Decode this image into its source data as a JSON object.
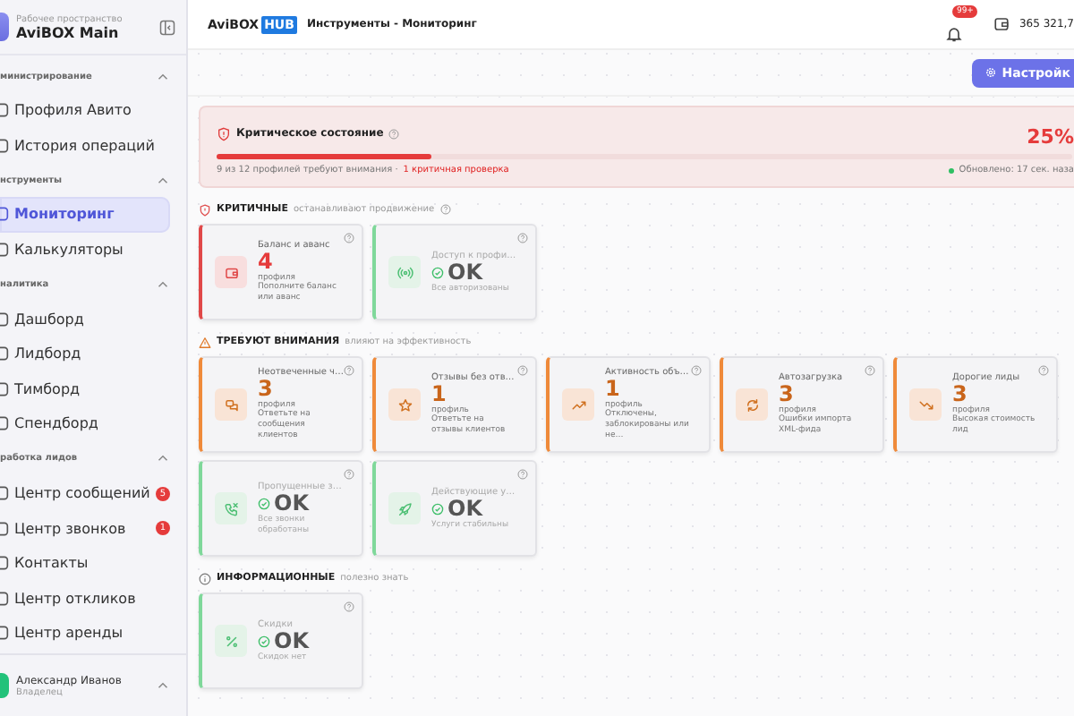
{
  "workspace": {
    "caption": "Рабочее пространство",
    "name": "AviBOX Main"
  },
  "sidebar": {
    "sections": [
      {
        "title": "министрирование",
        "expanded": true,
        "items": [
          {
            "label": "Профиля Авито",
            "selected": false
          },
          {
            "label": "История операций",
            "selected": false
          }
        ]
      },
      {
        "title": "нструменты",
        "expanded": true,
        "items": [
          {
            "label": "Мониторинг",
            "selected": true
          },
          {
            "label": "Калькуляторы",
            "selected": false
          }
        ]
      },
      {
        "title": "налитика",
        "expanded": true,
        "items": [
          {
            "label": "Дашборд",
            "selected": false
          },
          {
            "label": "Лидборд",
            "selected": false
          },
          {
            "label": "Тимборд",
            "selected": false
          },
          {
            "label": "Спендборд",
            "selected": false
          }
        ]
      },
      {
        "title": "работка лидов",
        "expanded": true,
        "items": [
          {
            "label": "Центр сообщений",
            "selected": false,
            "badge": "5"
          },
          {
            "label": "Центр звонков",
            "selected": false,
            "badge": "1"
          },
          {
            "label": "Контакты",
            "selected": false
          },
          {
            "label": "Центр откликов",
            "selected": false
          },
          {
            "label": "Центр аренды",
            "selected": false
          }
        ]
      }
    ]
  },
  "user": {
    "name": "Александр Иванов",
    "role": "Владелец"
  },
  "header": {
    "logo": "AviBOX",
    "logo_badge": "HUB",
    "title": "Инструменты - Мониторинг",
    "notifications": "99+",
    "balance": "365 321,7"
  },
  "toolbar": {
    "button": "Настройк"
  },
  "status_banner": {
    "title": "Критическое состояние",
    "level": 0.25,
    "percent": "25%",
    "summary": "9 из 12 профилей требуют внимания ·",
    "alert": "1 критичная проверка",
    "updated": "Обновлено: 17 сек. наза"
  },
  "sections": [
    {
      "kind": "critical",
      "title": "КРИТИЧНЫЕ",
      "subtitle": "останавливают продвижение",
      "cards": [
        {
          "kind": "critical",
          "title": "Баланс и аванс",
          "value": "4",
          "unit": "профиля",
          "desc": "Пополните баланс или аванс"
        },
        {
          "kind": "ok",
          "title": "Доступ к профи…",
          "value": "OK",
          "desc": "Все авторизованы"
        }
      ]
    },
    {
      "kind": "warning",
      "title": "ТРЕБУЮТ ВНИМАНИЯ",
      "subtitle": "влияют на эффективность",
      "cards": [
        {
          "kind": "warning",
          "title": "Неотвеченные ч…",
          "value": "3",
          "unit": "профиля",
          "desc": "Ответьте на сообщения клиентов"
        },
        {
          "kind": "warning",
          "title": "Отзывы без отв…",
          "value": "1",
          "unit": "профиль",
          "desc": "Ответьте на отзывы клиентов"
        },
        {
          "kind": "warning",
          "title": "Активность объ…",
          "value": "1",
          "unit": "профиль",
          "desc": "Отключены, заблокированы или не…"
        },
        {
          "kind": "warning",
          "title": "Автозагрузка",
          "value": "3",
          "unit": "профиля",
          "desc": "Ошибки импорта XML-фида"
        },
        {
          "kind": "warning",
          "title": "Дорогие лиды",
          "value": "3",
          "unit": "профиля",
          "desc": "Высокая стоимость лид"
        },
        {
          "kind": "ok",
          "title": "Пропущенные з…",
          "value": "OK",
          "desc": "Все звонки обработаны"
        },
        {
          "kind": "ok",
          "title": "Действующие у…",
          "value": "OK",
          "desc": "Услуги стабильны"
        }
      ]
    },
    {
      "kind": "info",
      "title": "ИНФОРМАЦИОННЫЕ",
      "subtitle": "полезно знать",
      "cards": [
        {
          "kind": "ok",
          "title": "Скидки",
          "value": "OK",
          "desc": "Скидок нет"
        }
      ]
    }
  ]
}
